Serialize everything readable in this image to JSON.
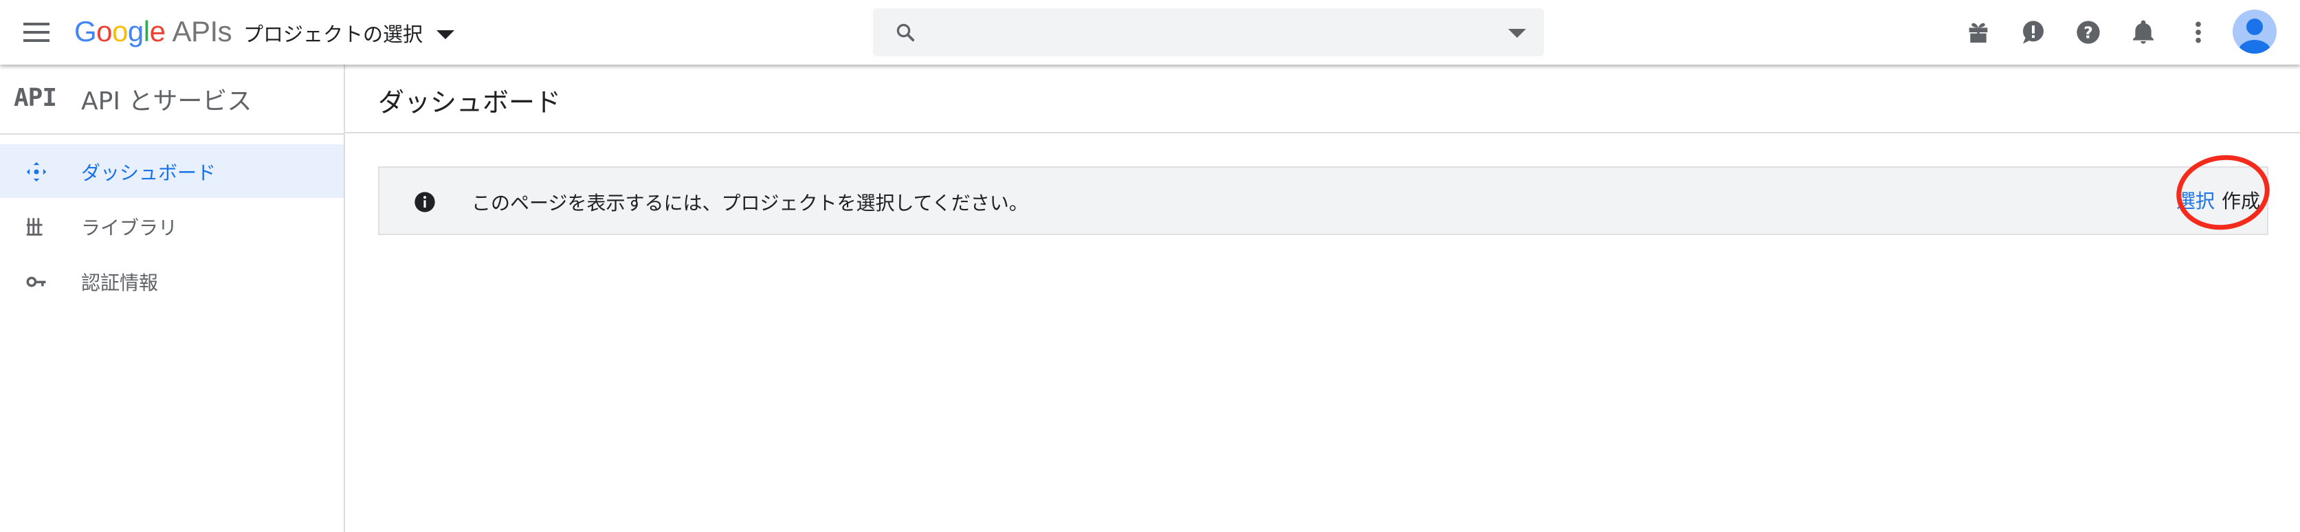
{
  "header": {
    "logo": {
      "G": "G",
      "o1": "o",
      "o2": "o",
      "g": "g",
      "l": "l",
      "e": "e",
      "apis": "APIs"
    },
    "project_picker_label": "プロジェクトの選択",
    "search_placeholder": "",
    "icons": [
      "gift-icon",
      "feedback-icon",
      "help-icon",
      "notifications-icon",
      "more-vert-icon",
      "account-avatar"
    ]
  },
  "sidebar": {
    "api_mark": "API",
    "title": "API とサービス",
    "items": [
      {
        "label": "ダッシュボード",
        "icon": "dashboard-icon",
        "active": true
      },
      {
        "label": "ライブラリ",
        "icon": "library-icon",
        "active": false
      },
      {
        "label": "認証情報",
        "icon": "key-icon",
        "active": false
      }
    ]
  },
  "main": {
    "title": "ダッシュボード",
    "banner": {
      "message": "このページを表示するには、プロジェクトを選択してください。",
      "select_label": "選択",
      "create_label": "作成"
    }
  },
  "colors": {
    "accent": "#1a73e8",
    "active_bg": "#e8f0fe",
    "annotation_circle": "#f42a1c",
    "banner_bg": "#f1f3f4"
  }
}
